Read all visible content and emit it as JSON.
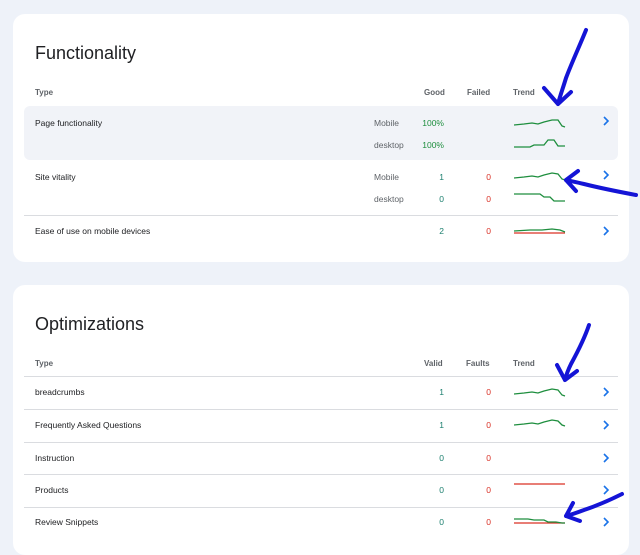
{
  "functionality": {
    "title": "Functionality",
    "headers": {
      "type": "Type",
      "good": "Good",
      "failed": "Failed",
      "trend": "Trend"
    },
    "rows": [
      {
        "label": "Page functionality",
        "devices": [
          {
            "name": "Mobile",
            "good": "100%",
            "failed": ""
          },
          {
            "name": "desktop",
            "good": "100%",
            "failed": ""
          }
        ]
      },
      {
        "label": "Site vitality",
        "devices": [
          {
            "name": "Mobile",
            "good": "1",
            "failed": "0"
          },
          {
            "name": "desktop",
            "good": "0",
            "failed": "0"
          }
        ]
      },
      {
        "label": "Ease of use on mobile devices",
        "good": "2",
        "failed": "0"
      }
    ]
  },
  "optimizations": {
    "title": "Optimizations",
    "headers": {
      "type": "Type",
      "valid": "Valid",
      "faults": "Faults",
      "trend": "Trend"
    },
    "rows": [
      {
        "label": "breadcrumbs",
        "valid": "1",
        "faults": "0"
      },
      {
        "label": "Frequently Asked Questions",
        "valid": "1",
        "faults": "0"
      },
      {
        "label": "Instruction",
        "valid": "0",
        "faults": "0"
      },
      {
        "label": "Products",
        "valid": "0",
        "faults": "0"
      },
      {
        "label": "Review Snippets",
        "valid": "0",
        "faults": "0"
      }
    ]
  },
  "colors": {
    "good": "#1e8e3e",
    "failed": "#d93025",
    "chevron": "#1a73e8",
    "annotation": "#1414d6"
  },
  "icons": {
    "row_action": "chevron-right-icon",
    "annotation": "hand-drawn-arrow"
  }
}
